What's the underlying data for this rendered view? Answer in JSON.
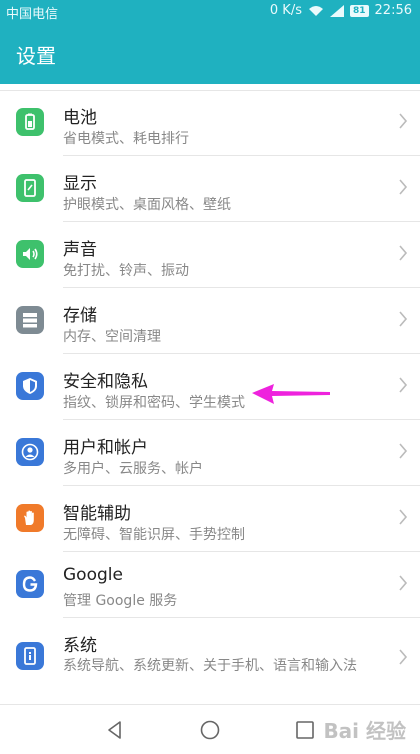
{
  "status_bar": {
    "carrier": "中国电信",
    "speed": "0 K/s",
    "battery": "81",
    "time": "22:56"
  },
  "app_bar": {
    "title": "设置"
  },
  "settings": [
    {
      "title": "电池",
      "subtitle": "省电模式、耗电排行",
      "icon": "battery-icon",
      "color": "#3ec16c"
    },
    {
      "title": "显示",
      "subtitle": "护眼模式、桌面风格、壁纸",
      "icon": "display-icon",
      "color": "#3ec16c"
    },
    {
      "title": "声音",
      "subtitle": "免打扰、铃声、振动",
      "icon": "sound-icon",
      "color": "#3ec16c"
    },
    {
      "title": "存储",
      "subtitle": "内存、空间清理",
      "icon": "storage-icon",
      "color": "#7e8b93"
    },
    {
      "title": "安全和隐私",
      "subtitle": "指纹、锁屏和密码、学生模式",
      "icon": "shield-icon",
      "color": "#3a78d8"
    },
    {
      "title": "用户和帐户",
      "subtitle": "多用户、云服务、帐户",
      "icon": "user-icon",
      "color": "#3a78d8"
    },
    {
      "title": "智能辅助",
      "subtitle": "无障碍、智能识屏、手势控制",
      "icon": "hand-icon",
      "color": "#f07a2a"
    },
    {
      "title": "Google",
      "subtitle": "管理 Google 服务",
      "icon": "google-icon",
      "color": "#3a78d8"
    },
    {
      "title": "系统",
      "subtitle": "系统导航、系统更新、关于手机、语言和输入法",
      "icon": "system-info-icon",
      "color": "#3a78d8"
    }
  ],
  "watermark": "Bai 经验",
  "colors": {
    "accent": "#1fb1c0",
    "annotation": "#ee22dd"
  }
}
